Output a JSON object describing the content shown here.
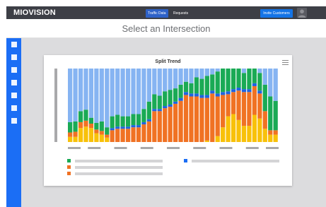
{
  "header": {
    "logo_text": "MIOVISION",
    "tabs": [
      {
        "label": "Traffic Data",
        "active": true
      },
      {
        "label": "Requests",
        "active": false
      }
    ],
    "invite_label": "Invite Customers"
  },
  "page": {
    "title": "Select an Intersection"
  },
  "sidebar": {
    "items": [
      "nav-1",
      "nav-2",
      "nav-3",
      "nav-4",
      "nav-5",
      "nav-6",
      "nav-7"
    ]
  },
  "card": {
    "title": "Split Trend",
    "menu_icon": "hamburger-icon"
  },
  "colors": {
    "blue_light": "#86b4f2",
    "green": "#1aaa55",
    "blue_dark": "#1e64e0",
    "orange": "#f07223",
    "yellow": "#f8c10a",
    "accent": "#1b6ef5"
  },
  "chart_data": {
    "type": "bar",
    "stacked": true,
    "normalized": true,
    "categories": [
      "1",
      "2",
      "3",
      "4",
      "5",
      "6",
      "7",
      "8",
      "9",
      "10",
      "11",
      "12",
      "13",
      "14",
      "15",
      "16",
      "17",
      "18",
      "19",
      "20",
      "21",
      "22",
      "23",
      "24",
      "25",
      "26",
      "27",
      "28",
      "29",
      "30",
      "31",
      "32",
      "33",
      "34",
      "35",
      "36",
      "37",
      "38",
      "39",
      "40"
    ],
    "series": [
      {
        "color_key": "yellow",
        "values": [
          0.07,
          0.07,
          0.19,
          0.21,
          0.19,
          0.12,
          0.1,
          0.06,
          0.0,
          0.0,
          0.0,
          0.0,
          0.0,
          0.0,
          0.0,
          0.0,
          0.0,
          0.0,
          0.0,
          0.0,
          0.0,
          0.0,
          0.0,
          0.0,
          0.0,
          0.0,
          0.02,
          0.0,
          0.08,
          0.2,
          0.35,
          0.38,
          0.3,
          0.22,
          0.22,
          0.37,
          0.32,
          0.18,
          0.1,
          0.1
        ]
      },
      {
        "color_key": "orange",
        "values": [
          0.06,
          0.07,
          0.08,
          0.08,
          0.06,
          0.05,
          0.05,
          0.04,
          0.16,
          0.18,
          0.18,
          0.18,
          0.2,
          0.2,
          0.24,
          0.28,
          0.42,
          0.42,
          0.46,
          0.48,
          0.52,
          0.56,
          0.64,
          0.62,
          0.62,
          0.6,
          0.58,
          0.66,
          0.54,
          0.44,
          0.3,
          0.3,
          0.4,
          0.46,
          0.46,
          0.39,
          0.34,
          0.24,
          0.06,
          0.06
        ]
      },
      {
        "color_key": "blue_dark",
        "values": [
          0.0,
          0.0,
          0.0,
          0.0,
          0.0,
          0.0,
          0.0,
          0.0,
          0.03,
          0.03,
          0.03,
          0.03,
          0.03,
          0.03,
          0.03,
          0.03,
          0.03,
          0.03,
          0.03,
          0.03,
          0.03,
          0.04,
          0.04,
          0.04,
          0.04,
          0.04,
          0.04,
          0.04,
          0.04,
          0.04,
          0.04,
          0.04,
          0.04,
          0.04,
          0.04,
          0.04,
          0.04,
          0.0,
          0.0,
          0.0
        ]
      },
      {
        "color_key": "green",
        "values": [
          0.14,
          0.14,
          0.15,
          0.15,
          0.08,
          0.09,
          0.13,
          0.1,
          0.16,
          0.16,
          0.14,
          0.14,
          0.15,
          0.15,
          0.18,
          0.24,
          0.2,
          0.18,
          0.2,
          0.2,
          0.18,
          0.18,
          0.14,
          0.14,
          0.22,
          0.22,
          0.26,
          0.22,
          0.3,
          0.32,
          0.31,
          0.28,
          0.26,
          0.22,
          0.28,
          0.2,
          0.24,
          0.36,
          0.46,
          0.4
        ]
      },
      {
        "color_key": "blue_light",
        "values": [
          0.73,
          0.72,
          0.58,
          0.56,
          0.67,
          0.74,
          0.72,
          0.8,
          0.65,
          0.63,
          0.65,
          0.65,
          0.62,
          0.62,
          0.55,
          0.45,
          0.35,
          0.37,
          0.31,
          0.29,
          0.27,
          0.22,
          0.18,
          0.2,
          0.12,
          0.14,
          0.1,
          0.08,
          0.04,
          0.0,
          0.0,
          0.0,
          0.0,
          0.06,
          0.0,
          0.0,
          0.06,
          0.22,
          0.38,
          0.44
        ]
      }
    ],
    "title": "Split Trend"
  },
  "legend": {
    "left": [
      {
        "color_key": "green"
      },
      {
        "color_key": "orange"
      },
      {
        "color_key": "orange"
      }
    ],
    "right": [
      {
        "color_key": "accent"
      }
    ]
  }
}
